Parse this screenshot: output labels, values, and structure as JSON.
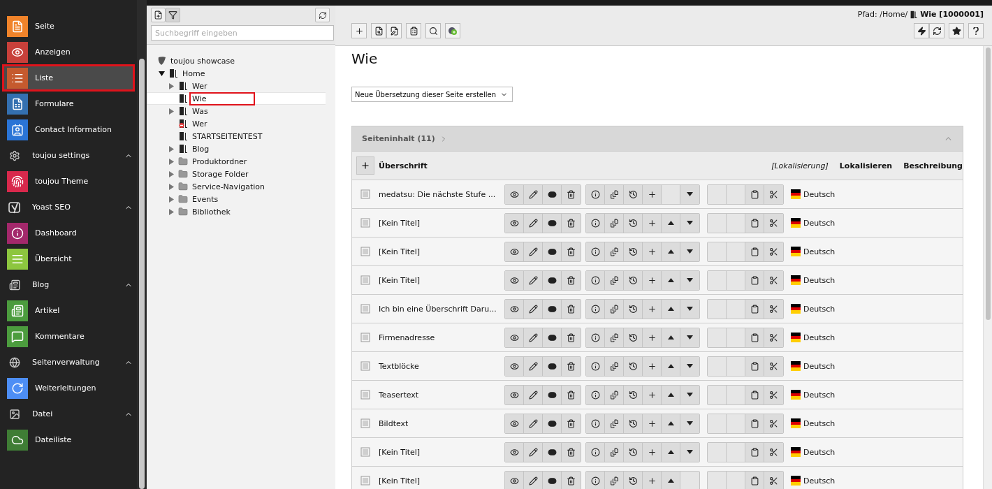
{
  "sidebar": {
    "items": [
      {
        "kind": "module",
        "label": "Seite",
        "color": "#f0832a",
        "selected": false
      },
      {
        "kind": "module",
        "label": "Anzeigen",
        "color": "#c8403a",
        "selected": false
      },
      {
        "kind": "module",
        "label": "Liste",
        "color": "#c55a2e",
        "selected": true
      },
      {
        "kind": "module",
        "label": "Formulare",
        "color": "#3470b0",
        "selected": false
      },
      {
        "kind": "module",
        "label": "Contact Information",
        "color": "#2a74d6",
        "selected": false
      },
      {
        "kind": "group",
        "label": "toujou settings",
        "expanded": true
      },
      {
        "kind": "module",
        "label": "toujou Theme",
        "color": "#d8294c",
        "selected": false
      },
      {
        "kind": "group",
        "label": "Yoast SEO",
        "expanded": true
      },
      {
        "kind": "module",
        "label": "Dashboard",
        "color": "#a3286b",
        "selected": false
      },
      {
        "kind": "module",
        "label": "Übersicht",
        "color": "#8dc63f",
        "selected": false
      },
      {
        "kind": "group",
        "label": "Blog",
        "expanded": true
      },
      {
        "kind": "module",
        "label": "Artikel",
        "color": "#4c9c3e",
        "selected": false
      },
      {
        "kind": "module",
        "label": "Kommentare",
        "color": "#4c9c3e",
        "selected": false
      },
      {
        "kind": "group",
        "label": "Seitenverwaltung",
        "expanded": true
      },
      {
        "kind": "module",
        "label": "Weiterleitungen",
        "color": "#4d8ef5",
        "selected": false
      },
      {
        "kind": "group",
        "label": "Datei",
        "expanded": true
      },
      {
        "kind": "module",
        "label": "Dateiliste",
        "color": "#3f7d35",
        "selected": false
      }
    ]
  },
  "page_tree": {
    "search": {
      "placeholder": "Suchbegriff eingeben"
    },
    "root": {
      "label": "toujou showcase",
      "children": [
        {
          "label": "Home",
          "kind": "page",
          "expandable": true,
          "expanded": true,
          "selected": false,
          "children": [
            {
              "label": "Wer",
              "kind": "page",
              "expandable": true,
              "expanded": false,
              "selected": false
            },
            {
              "label": "Wie",
              "kind": "page",
              "expandable": false,
              "selected": true
            },
            {
              "label": "Was",
              "kind": "page",
              "expandable": true,
              "expanded": false,
              "selected": false
            },
            {
              "label": "Wer",
              "kind": "restricted",
              "expandable": false,
              "selected": false
            },
            {
              "label": "STARTSEITENTEST",
              "kind": "page",
              "expandable": false,
              "selected": false
            },
            {
              "label": "Blog",
              "kind": "page",
              "expandable": true,
              "expanded": false,
              "selected": false
            },
            {
              "label": "Produktordner",
              "kind": "folder",
              "expandable": true,
              "expanded": false,
              "selected": false
            },
            {
              "label": "Storage Folder",
              "kind": "folder",
              "expandable": true,
              "expanded": false,
              "selected": false
            },
            {
              "label": "Service-Navigation",
              "kind": "folder",
              "expandable": true,
              "expanded": false,
              "selected": false
            },
            {
              "label": "Events",
              "kind": "folder",
              "expandable": true,
              "expanded": false,
              "selected": false
            },
            {
              "label": "Bibliothek",
              "kind": "folder",
              "expandable": true,
              "expanded": false,
              "selected": false
            }
          ]
        }
      ]
    }
  },
  "docheader": {
    "path_prefix": "Pfad: /Home/",
    "path_page": "Wie [1000001]"
  },
  "content": {
    "title": "Wie",
    "translation_select": "Neue Übersetzung dieser Seite erstellen",
    "panel": {
      "title": "Seiteninhalt (11)",
      "expanded": true,
      "columns": {
        "title": "Überschrift",
        "localization": "[Lokalisierung]",
        "localize": "Lokalisieren",
        "description": "Beschreibung"
      },
      "rows": [
        {
          "title": "medatsu: Die nächste Stufe ...",
          "language": "Deutsch",
          "can_move_up": false,
          "can_move_down": true
        },
        {
          "title": "[Kein Titel]",
          "language": "Deutsch",
          "can_move_up": true,
          "can_move_down": true
        },
        {
          "title": "[Kein Titel]",
          "language": "Deutsch",
          "can_move_up": true,
          "can_move_down": true
        },
        {
          "title": "[Kein Titel]",
          "language": "Deutsch",
          "can_move_up": true,
          "can_move_down": true
        },
        {
          "title": "Ich bin eine Überschrift Daru...",
          "language": "Deutsch",
          "can_move_up": true,
          "can_move_down": true
        },
        {
          "title": "Firmenadresse",
          "language": "Deutsch",
          "can_move_up": true,
          "can_move_down": true
        },
        {
          "title": "Textblöcke",
          "language": "Deutsch",
          "can_move_up": true,
          "can_move_down": true
        },
        {
          "title": "Teasertext",
          "language": "Deutsch",
          "can_move_up": true,
          "can_move_down": true
        },
        {
          "title": "Bildtext",
          "language": "Deutsch",
          "can_move_up": true,
          "can_move_down": true
        },
        {
          "title": "[Kein Titel]",
          "language": "Deutsch",
          "can_move_up": true,
          "can_move_down": true
        },
        {
          "title": "[Kein Titel]",
          "language": "Deutsch",
          "can_move_up": true,
          "can_move_down": false
        }
      ]
    }
  }
}
